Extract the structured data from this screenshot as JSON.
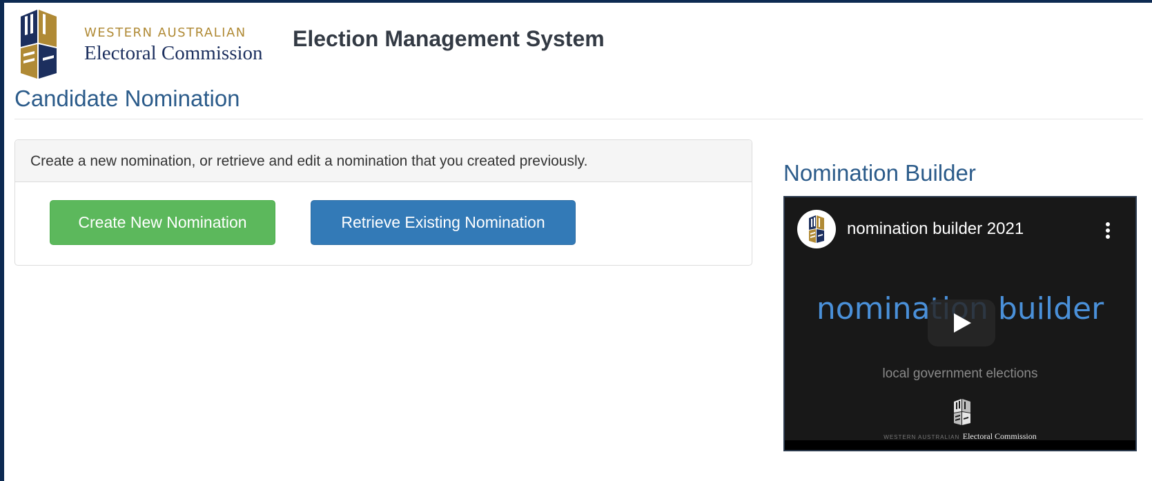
{
  "header": {
    "logo": {
      "icon": "waec-logo-icon",
      "line1": "WESTERN AUSTRALIAN",
      "line2": "Electoral Commission",
      "colors": {
        "gold": "#b08a35",
        "navy": "#1c2f5e"
      }
    },
    "system_title": "Election Management System"
  },
  "page_title": "Candidate Nomination",
  "panel": {
    "heading": "Create a new nomination, or retrieve and edit a nomination that you created previously.",
    "create_button": "Create New Nomination",
    "retrieve_button": "Retrieve Existing Nomination"
  },
  "builder": {
    "title": "Nomination Builder",
    "video": {
      "title": "nomination builder 2021",
      "big_text": "nomination builder",
      "subtitle": "local government elections",
      "watermark_small": "WESTERN AUSTRALIAN",
      "watermark_large": "Electoral Commission",
      "play_icon": "play-icon",
      "menu_icon": "more-vert-icon"
    }
  },
  "colors": {
    "frame": "#0d2a52",
    "heading_blue": "#2b5b8a",
    "button_green": "#5cb85c",
    "button_blue": "#337ab7",
    "video_text_blue": "#4a90d9"
  }
}
